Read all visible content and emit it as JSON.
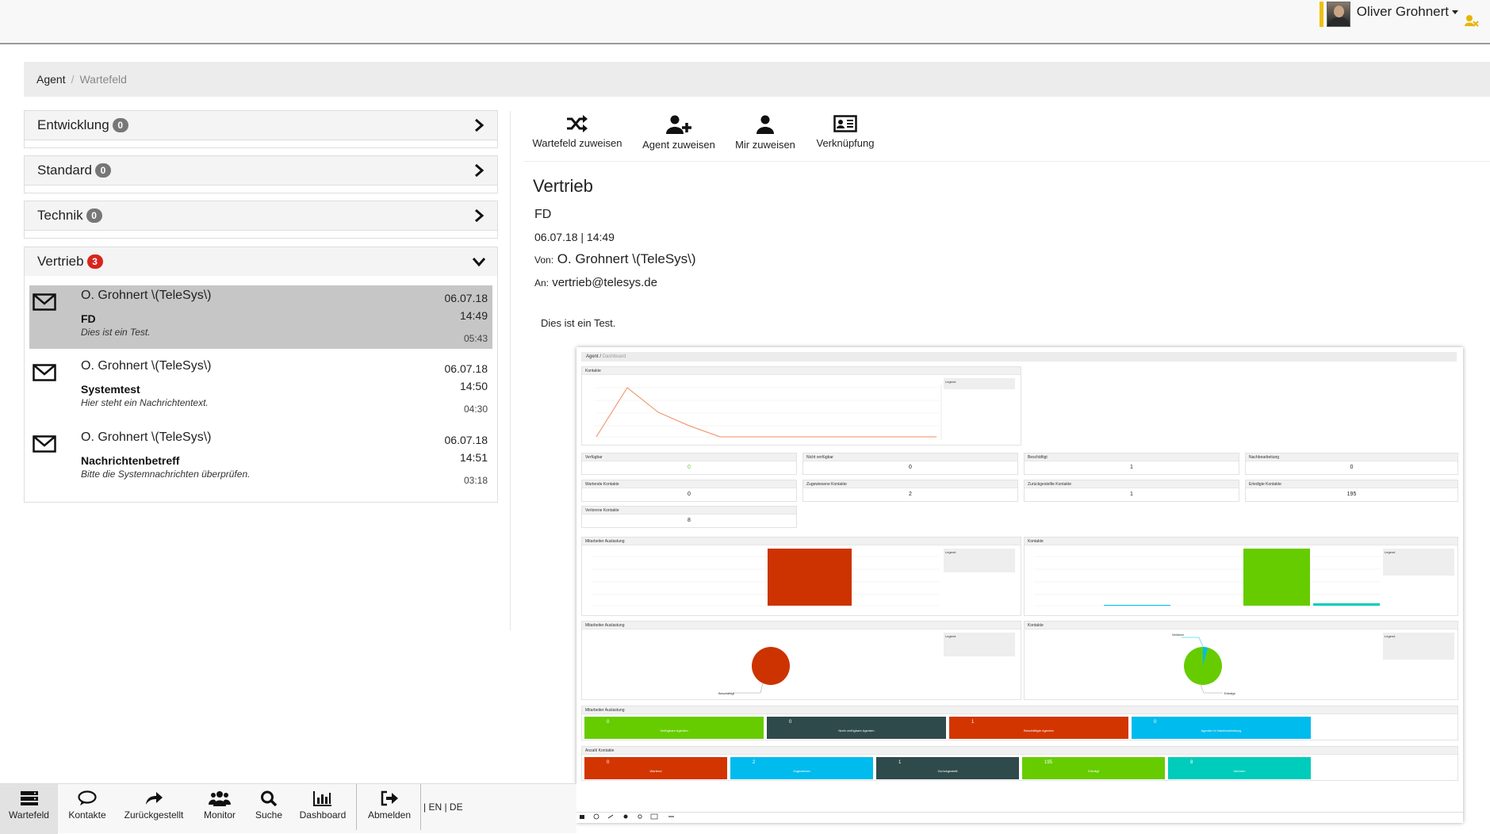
{
  "header": {
    "user_name": "Oliver Grohnert"
  },
  "breadcrumb": {
    "items": [
      "Agent",
      "Wartefeld"
    ]
  },
  "queues": [
    {
      "name": "Entwicklung",
      "count": "0",
      "expanded": false
    },
    {
      "name": "Standard",
      "count": "0",
      "expanded": false
    },
    {
      "name": "Technik",
      "count": "0",
      "expanded": false
    },
    {
      "name": "Vertrieb",
      "count": "3",
      "expanded": true
    }
  ],
  "messages": [
    {
      "from": "O. Grohnert \\(TeleSys\\)",
      "date": "06.07.18",
      "time": "14:49",
      "subject": "FD",
      "preview": "Dies ist ein Test.",
      "duration": "05:43",
      "selected": true
    },
    {
      "from": "O. Grohnert \\(TeleSys\\)",
      "date": "06.07.18",
      "time": "14:50",
      "subject": "Systemtest",
      "preview": "Hier steht ein Nachrichtentext.",
      "duration": "04:30",
      "selected": false
    },
    {
      "from": "O. Grohnert \\(TeleSys\\)",
      "date": "06.07.18",
      "time": "14:51",
      "subject": "Nachrichtenbetreff",
      "preview": "Bitte die Systemnachrichten überprüfen.",
      "duration": "03:18",
      "selected": false
    }
  ],
  "toolbar": {
    "assign_queue": "Wartefeld zuweisen",
    "assign_agent": "Agent zuweisen",
    "assign_me": "Mir zuweisen",
    "link": "Verknüpfung"
  },
  "detail": {
    "queue": "Vertrieb",
    "subject": "FD",
    "datetime": "06.07.18 | 14:49",
    "from_label": "Von:",
    "from": "O. Grohnert \\(TeleSys\\)",
    "to_label": "An:",
    "to": "vertrieb@telesys.de",
    "body": "Dies ist ein Test."
  },
  "embedded": {
    "breadcrumb": [
      "Agent",
      "Dashboard"
    ],
    "line_title": "Kontakte",
    "legend_label": "Legend",
    "stats": [
      {
        "label": "Verfügbar",
        "value": "0"
      },
      {
        "label": "Nicht verfügbar",
        "value": "0"
      },
      {
        "label": "Beschäftigt",
        "value": "1"
      },
      {
        "label": "Nachbearbeitung",
        "value": "0"
      },
      {
        "label": "Wartende Kontakte",
        "value": "0"
      },
      {
        "label": "Zugewiesene Kontakte",
        "value": "2"
      },
      {
        "label": "Zurückgestellte Kontakte",
        "value": "1"
      },
      {
        "label": "Erledigte Kontakte",
        "value": "195"
      },
      {
        "label": "Verlorene Kontakte",
        "value": "8"
      }
    ],
    "bar_left_title": "Mitarbeiter Auslastung",
    "bar_right_title": "Kontakte",
    "pie_left_title": "Mitarbeiter Auslastung",
    "pie_right_title": "Kontakte",
    "pie_left_label": "Beschäftigt",
    "pie_right_label_top": "Verloren",
    "pie_right_label_bottom": "Erledigt",
    "tiles_row1_title": "Mitarbeiter Auslastung",
    "tiles_row1": [
      {
        "value": "0",
        "label": "Verfügbare Agenten",
        "color": "#66cc00"
      },
      {
        "value": "0",
        "label": "Nicht verfügbare Agenten",
        "color": "#2f4a4a"
      },
      {
        "value": "1",
        "label": "Beschäftigte Agenten",
        "color": "#d33500"
      },
      {
        "value": "0",
        "label": "Agenten in Nachbearbeitung",
        "color": "#00bbee"
      }
    ],
    "tiles_row2_title": "Anzahl Kontakte",
    "tiles_row2": [
      {
        "value": "0",
        "label": "Wartend",
        "color": "#d33500"
      },
      {
        "value": "2",
        "label": "Zugewiesen",
        "color": "#00bbee"
      },
      {
        "value": "1",
        "label": "Zurückgestellt",
        "color": "#2f4a4a"
      },
      {
        "value": "195",
        "label": "Erledigt",
        "color": "#66cc00"
      },
      {
        "value": "8",
        "label": "Verloren",
        "color": "#00ccbb"
      }
    ]
  },
  "nav": {
    "items": [
      "Wartefeld",
      "Kontakte",
      "Zurückgestellt",
      "Monitor",
      "Suche",
      "Dashboard",
      "Abmelden"
    ],
    "lang": "| EN | DE"
  },
  "colors": {
    "selected_row": "#c6c6c6",
    "badge_alert": "#d9241c",
    "accent_yellow": "#f0c010"
  }
}
